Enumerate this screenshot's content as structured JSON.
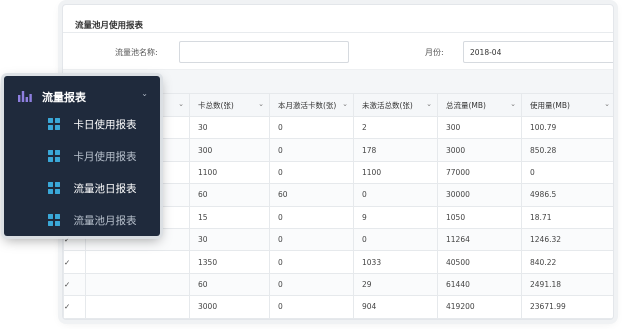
{
  "report": {
    "title": "流量池月使用报表",
    "filters": {
      "pool_name_label": "流量池名称:",
      "pool_name_value": "",
      "month_label": "月份:",
      "month_value": "2018-04"
    },
    "columns": [
      "",
      "卡总数(张)",
      "本月激活卡数(张)",
      "未激活总数(张)",
      "总流量(MB)",
      "使用量(MB)"
    ],
    "rows": [
      [
        "",
        "30",
        "0",
        "2",
        "300",
        "100.79"
      ],
      [
        "",
        "300",
        "0",
        "178",
        "3000",
        "850.28"
      ],
      [
        "",
        "1100",
        "0",
        "1100",
        "77000",
        "0"
      ],
      [
        "",
        "60",
        "60",
        "0",
        "30000",
        "4986.5"
      ],
      [
        "",
        "15",
        "0",
        "9",
        "1050",
        "18.71"
      ],
      [
        "",
        "30",
        "0",
        "0",
        "11264",
        "1246.32"
      ],
      [
        "",
        "1350",
        "0",
        "1033",
        "40500",
        "840.22"
      ],
      [
        "",
        "60",
        "0",
        "29",
        "61440",
        "2491.18"
      ],
      [
        "",
        "3000",
        "0",
        "904",
        "419200",
        "23671.99"
      ]
    ]
  },
  "menu": {
    "header_label": "流量报表",
    "header_icon": "bar-chart-icon",
    "items": [
      {
        "label": "卡日使用报表",
        "icon": "grid-tile-icon",
        "active": true
      },
      {
        "label": "卡月使用报表",
        "icon": "grid-tile-icon",
        "active": false
      },
      {
        "label": "流量池日报表",
        "icon": "grid-tile-icon",
        "active": true
      },
      {
        "label": "流量池月报表",
        "icon": "grid-tile-icon",
        "active": false
      }
    ]
  },
  "colors": {
    "menu_bg": "#1f2a3c",
    "tile_accent": "#3aa8d8",
    "menu_header_icon": "#8e7fe0"
  }
}
